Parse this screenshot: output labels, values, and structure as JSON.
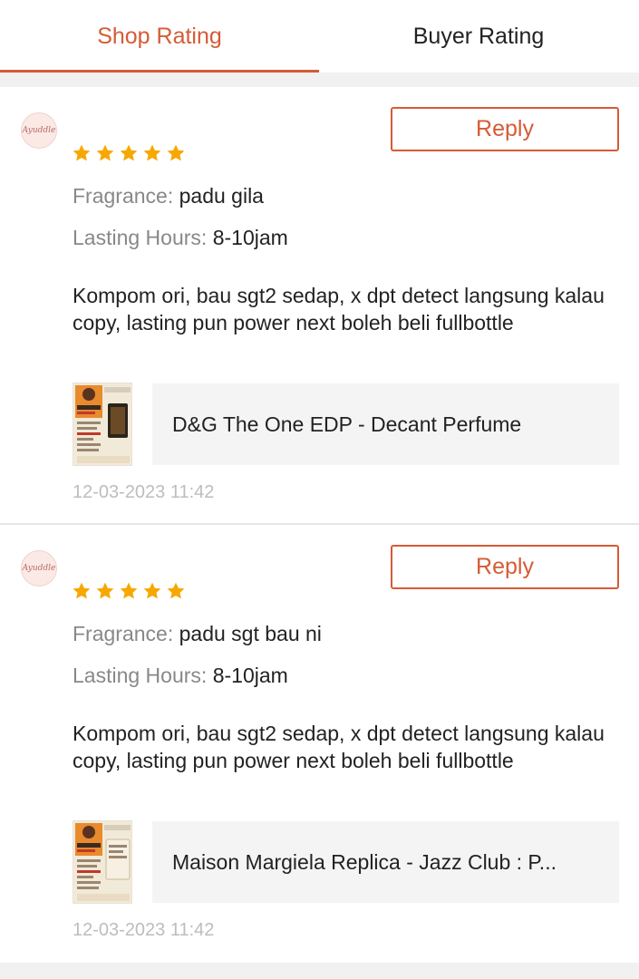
{
  "tabs": [
    {
      "label": "Shop Rating",
      "active": true
    },
    {
      "label": "Buyer Rating",
      "active": false
    }
  ],
  "colors": {
    "accent": "#d55b36",
    "star": "#f6a800",
    "label_gray": "#888888",
    "date_gray": "#bdbdbd"
  },
  "reviews": [
    {
      "avatar_text": "Ayuddle",
      "rating": 5,
      "reply_label": "Reply",
      "fragrance_label": "Fragrance:",
      "fragrance_value": "padu gila",
      "lasting_label": "Lasting Hours:",
      "lasting_value": "8-10jam",
      "comment": "Kompom ori, bau sgt2 sedap, x dpt detect langsung kalau copy, lasting pun power next boleh beli fullbottle",
      "product_title": "D&G The One EDP - Decant Perfume",
      "date": "12-03-2023 11:42"
    },
    {
      "avatar_text": "Ayuddle",
      "rating": 5,
      "reply_label": "Reply",
      "fragrance_label": "Fragrance:",
      "fragrance_value": "padu sgt bau ni",
      "lasting_label": "Lasting Hours:",
      "lasting_value": "8-10jam",
      "comment": "Kompom ori, bau sgt2 sedap, x dpt detect langsung kalau copy, lasting pun power next boleh beli fullbottle",
      "product_title": "Maison Margiela Replica - Jazz Club : P...",
      "date": "12-03-2023 11:42"
    }
  ]
}
